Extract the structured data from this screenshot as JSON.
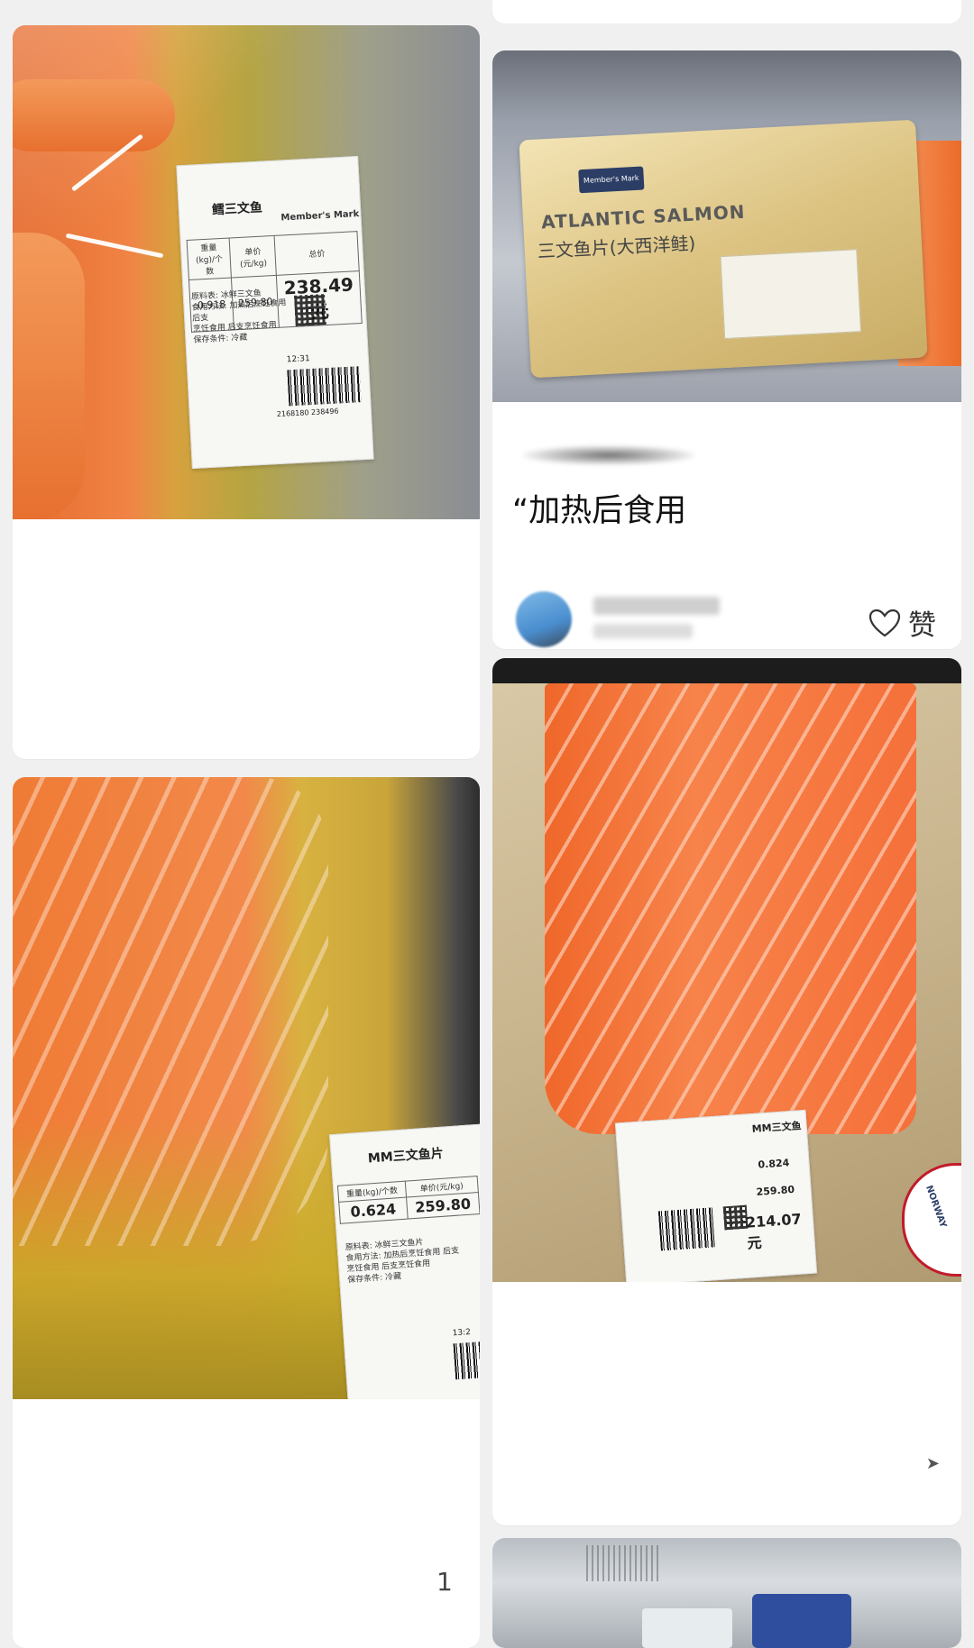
{
  "left_card_1": {
    "label": {
      "name": "鳕三文鱼",
      "brand": "Member's Mark",
      "headers": [
        "重量(kg)/个数",
        "单价(元/kg)",
        "总价"
      ],
      "weight": "0.918",
      "unit_price": "259.80",
      "total": "238.49元",
      "description": "原料表:  冰鲜三文鱼\n食用方法: 加热后烹饪食用 后支\n烹饪食用 后支烹饪食用\n保存条件: 冷藏",
      "time": "12:31",
      "barcode": "2168180 238496"
    }
  },
  "left_card_2": {
    "label": {
      "name": "MM三文鱼片",
      "headers": [
        "重量(kg)/个数",
        "单价(元/kg)"
      ],
      "weight": "0.624",
      "unit_price": "259.80",
      "description": "原料表:  冰鲜三文鱼片\n食用方法: 加热后烹饪食用 后支\n烹饪食用 后支烹饪食用\n保存条件: 冷藏",
      "time": "13:2"
    }
  },
  "right_card_1": {
    "product_title_en": "ATLANTIC SALMON",
    "product_title_cn": "三文鱼片(大西洋鲑)",
    "logo_text": "Member's Mark",
    "post_title": "“加热后食用",
    "like_label": "赞"
  },
  "right_card_2": {
    "label": {
      "name": "MM三文鱼",
      "weight": "0.824",
      "unit_price": "259.80",
      "total": "214.07元"
    },
    "badge": "NORWAY"
  },
  "page_number": "1",
  "colors": {
    "background": "#f0f0f0",
    "card": "#ffffff",
    "salmon": "#f07a36",
    "gold": "#d8c07a"
  }
}
